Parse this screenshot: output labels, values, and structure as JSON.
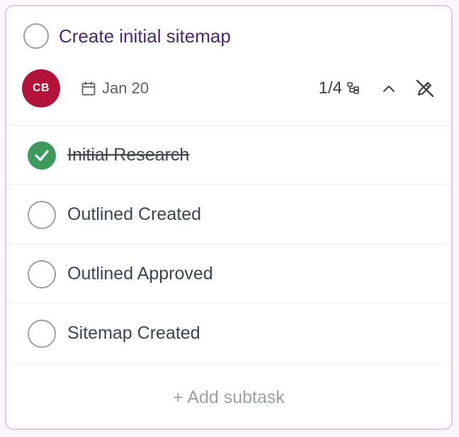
{
  "task": {
    "title": "Create initial sitemap",
    "assignee_initials": "CB",
    "due_date": "Jan 20",
    "subtask_progress": "1/4",
    "colors": {
      "title": "#4a2771",
      "avatar": "#b3123b",
      "done": "#3f9a5e"
    },
    "icons": {
      "date": "calendar-icon",
      "progress": "subtask-tree-icon",
      "collapse": "chevron-up-icon",
      "edit": "pencil-off-icon"
    }
  },
  "subtasks": [
    {
      "label": "Initial Research",
      "done": true
    },
    {
      "label": "Outlined Created",
      "done": false
    },
    {
      "label": "Outlined Approved",
      "done": false
    },
    {
      "label": "Sitemap Created",
      "done": false
    }
  ],
  "add_subtask_label": "+ Add subtask"
}
